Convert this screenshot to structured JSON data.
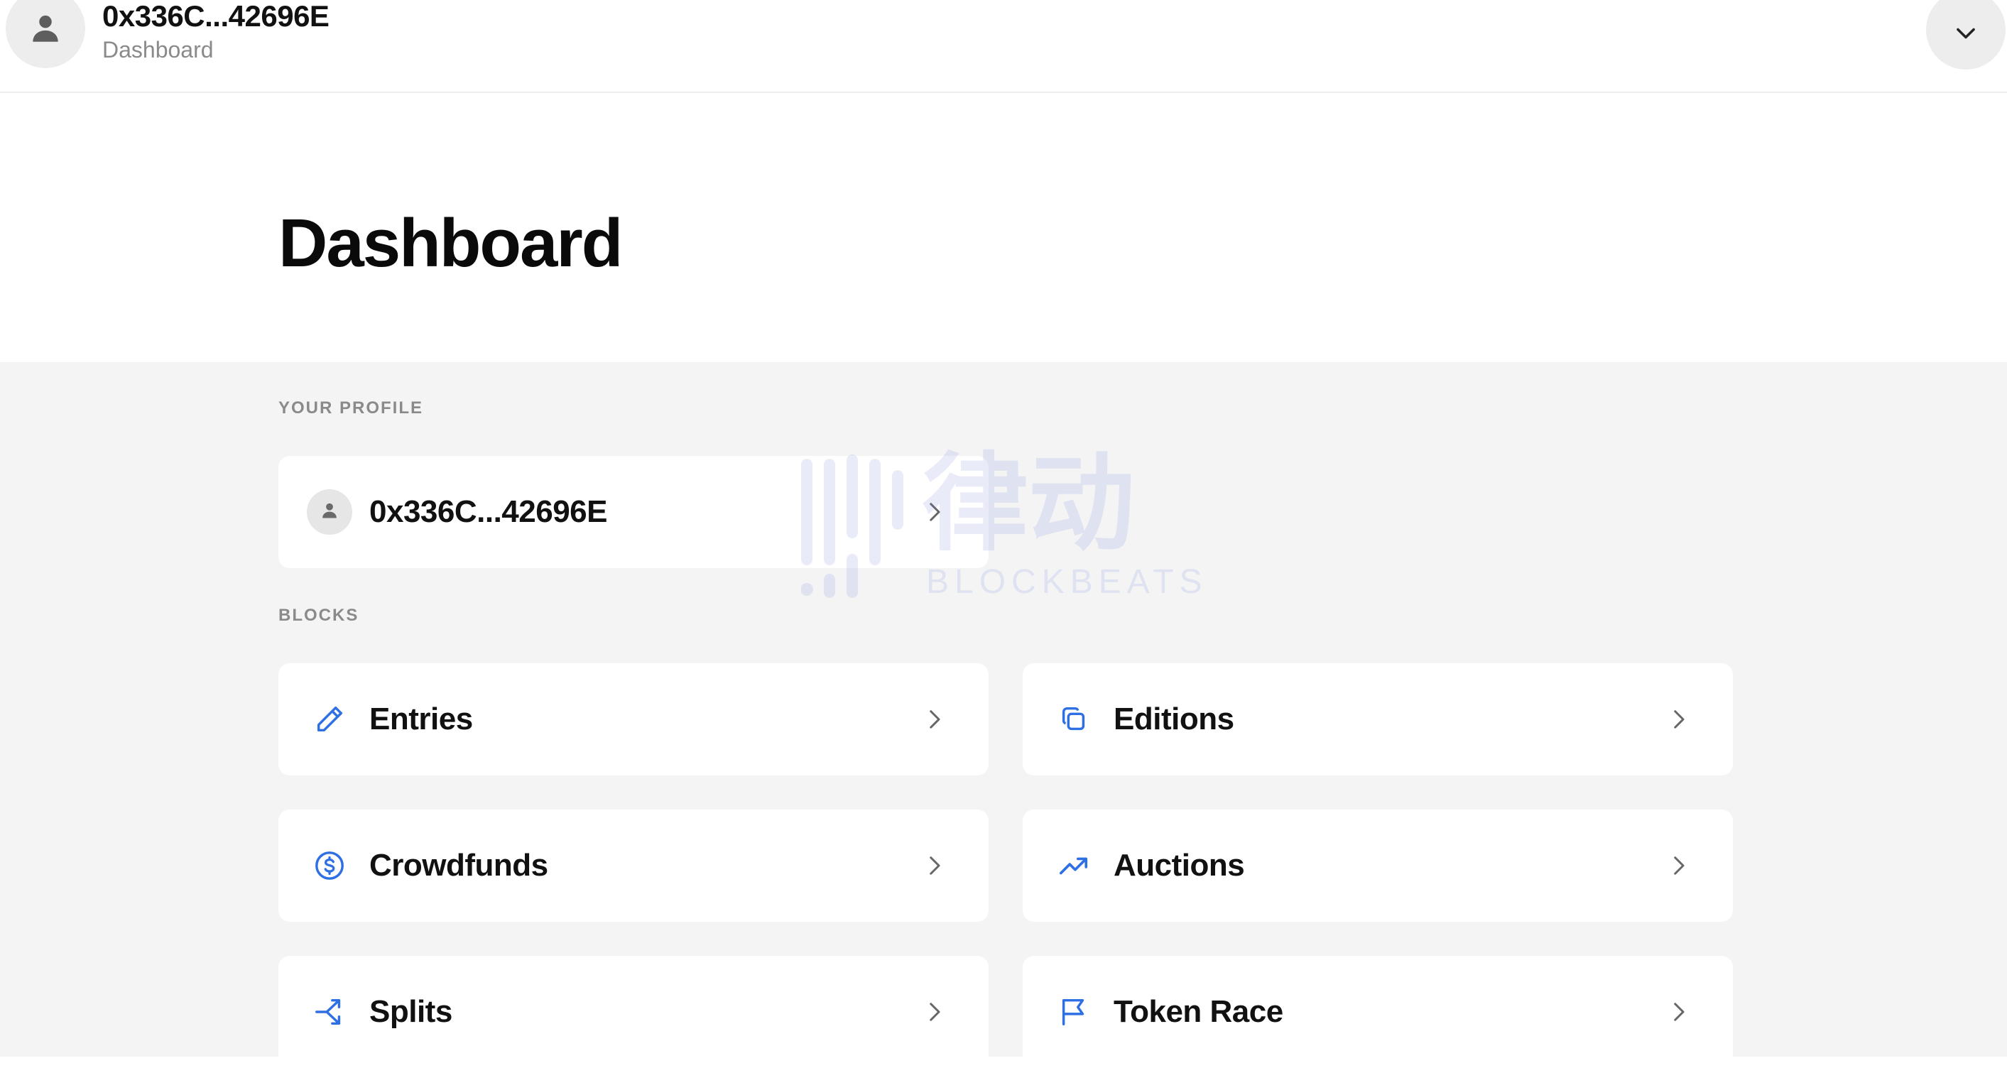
{
  "header": {
    "address": "0x336C...42696E",
    "subtitle": "Dashboard",
    "menu_toggle_icon": "chevron-down-icon",
    "avatar_icon": "user-icon"
  },
  "page": {
    "title": "Dashboard"
  },
  "profile_section": {
    "label": "YOUR PROFILE",
    "address": "0x336C...42696E",
    "avatar_icon": "user-icon"
  },
  "blocks_section": {
    "label": "BLOCKS",
    "items": [
      {
        "label": "Entries",
        "icon": "pencil-icon"
      },
      {
        "label": "Editions",
        "icon": "copy-icon"
      },
      {
        "label": "Crowdfunds",
        "icon": "dollar-circle-icon"
      },
      {
        "label": "Auctions",
        "icon": "trending-up-icon"
      },
      {
        "label": "Splits",
        "icon": "split-arrows-icon"
      },
      {
        "label": "Token Race",
        "icon": "flag-icon"
      }
    ]
  },
  "watermark": {
    "cn": "律动",
    "en": "BLOCKBEATS"
  },
  "colors": {
    "accent": "#2f6fe4",
    "background": "#f4f4f4",
    "card": "#ffffff",
    "muted_text": "#8a8a8a"
  }
}
